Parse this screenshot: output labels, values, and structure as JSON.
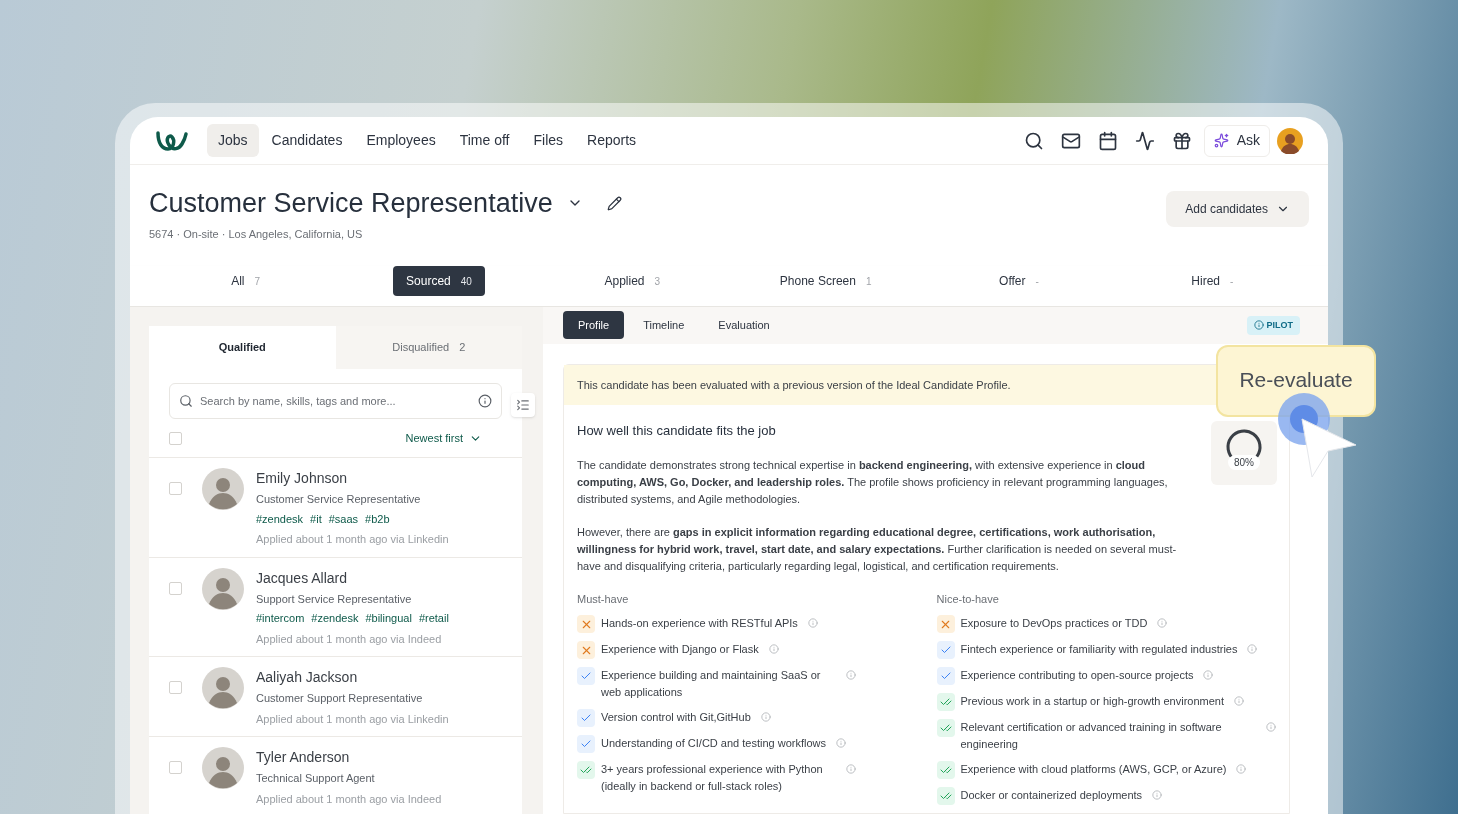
{
  "nav": {
    "items": [
      {
        "label": "Jobs",
        "selected": true
      },
      {
        "label": "Candidates",
        "selected": false
      },
      {
        "label": "Employees",
        "selected": false
      },
      {
        "label": "Time off",
        "selected": false
      },
      {
        "label": "Files",
        "selected": false
      },
      {
        "label": "Reports",
        "selected": false
      }
    ],
    "ask": "Ask"
  },
  "job": {
    "title": "Customer Service Representative",
    "meta": "5674 · On-site · Los Angeles, California, US",
    "add_button": "Add candidates"
  },
  "stages": [
    {
      "label": "All",
      "count": "7",
      "selected": false
    },
    {
      "label": "Sourced",
      "count": "40",
      "selected": true
    },
    {
      "label": "Applied",
      "count": "3",
      "selected": false
    },
    {
      "label": "Phone Screen",
      "count": "1",
      "selected": false
    },
    {
      "label": "Offer",
      "count": "-",
      "selected": false
    },
    {
      "label": "Hired",
      "count": "-",
      "selected": false
    }
  ],
  "list": {
    "tabs": [
      {
        "label": "Qualified",
        "selected": true
      },
      {
        "label": "Disqualified",
        "count": "2",
        "selected": false
      }
    ],
    "search": {
      "placeholder": "Search by name, skills, tags and more..."
    },
    "sort": "Newest first",
    "select_all": {
      "checked": false
    },
    "candidates": [
      {
        "name": "Emily Johnson",
        "role": "Customer Service Representative",
        "tags": [
          "#zendesk",
          "#it",
          "#saas",
          "#b2b"
        ],
        "applied": "Applied about 1 month ago via Linkedin",
        "checked": false
      },
      {
        "name": "Jacques Allard",
        "role": "Support Service Representative",
        "tags": [
          "#intercom",
          "#zendesk",
          "#bilingual",
          "#retail"
        ],
        "applied": "Applied about 1 month ago via Indeed",
        "checked": false
      },
      {
        "name": "Aaliyah Jackson",
        "role": "Customer Support Representative",
        "applied": "Applied about 1 month ago via Linkedin",
        "checked": false
      },
      {
        "name": "Tyler Anderson",
        "role": "Technical Support Agent",
        "applied": "Applied about 1 month ago via Indeed",
        "checked": false
      }
    ]
  },
  "profile": {
    "tabs": [
      {
        "label": "Profile",
        "selected": true
      },
      {
        "label": "Timeline",
        "selected": false
      },
      {
        "label": "Evaluation",
        "selected": false
      }
    ],
    "badge": "PILOT",
    "notice": "This candidate has been evaluated with a previous version of the Ideal Candidate Profile.",
    "fit_title": "How well this candidate fits the job",
    "paragraphs": [
      "The candidate demonstrates strong technical expertise in **backend engineering,** with extensive experience in **cloud computing, AWS, Go, Docker, and leadership roles.** The profile shows proficiency in relevant programming languages, distributed systems, and Agile methodologies.",
      "However, there are **gaps in explicit information regarding educational degree, certifications, work authorisation, willingness for hybrid work, travel, start date, and salary expectations.** Further clarification is needed on several must-have and disqualifying criteria, particularly regarding legal, logistical, and certification requirements."
    ],
    "score": {
      "level": 0.8,
      "label": "80%"
    },
    "criteria": [
      {
        "title": "Must-have",
        "items": [
          {
            "kind": "missing",
            "text": "Hands-on experience with RESTful APIs"
          },
          {
            "kind": "missing",
            "text": "Experience with Django or Flask"
          },
          {
            "kind": "partial",
            "text": "Experience building and maintaining SaaS or web applications"
          },
          {
            "kind": "partial",
            "text": "Version control with Git,GitHub"
          },
          {
            "kind": "partial",
            "text": "Understanding of CI/CD and testing workflows"
          },
          {
            "kind": "met",
            "text": "3+ years professional experience with Python (ideally in backend or full-stack roles)"
          }
        ]
      },
      {
        "title": "Nice-to-have",
        "items": [
          {
            "kind": "missing",
            "text": "Exposure to DevOps practices or TDD"
          },
          {
            "kind": "partial",
            "text": "Fintech experience or familiarity with regulated industries"
          },
          {
            "kind": "partial",
            "text": "Experience contributing to open-source projects"
          },
          {
            "kind": "met",
            "text": "Previous work in a startup or high-growth environment"
          },
          {
            "kind": "met",
            "text": "Relevant certification or advanced training in software engineering"
          },
          {
            "kind": "met",
            "text": "Experience with cloud platforms (AWS, GCP, or Azure)"
          },
          {
            "kind": "met",
            "text": "Docker or containerized deployments"
          }
        ]
      }
    ]
  },
  "tooltip": {
    "label": "Re-evaluate"
  }
}
